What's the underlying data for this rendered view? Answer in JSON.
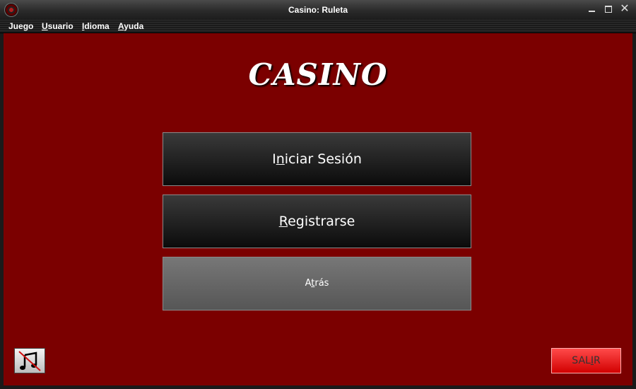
{
  "window": {
    "title": "Casino: Ruleta"
  },
  "menu": [
    {
      "pre": "Jue",
      "key": "g",
      "post": "o"
    },
    {
      "pre": "",
      "key": "U",
      "post": "suario"
    },
    {
      "pre": "",
      "key": "I",
      "post": "dioma"
    },
    {
      "pre": "",
      "key": "A",
      "post": "yuda"
    }
  ],
  "heading": "CASINO",
  "buttons": {
    "login": {
      "pre": "I",
      "key": "n",
      "post": "iciar Sesión"
    },
    "register": {
      "pre": "",
      "key": "R",
      "post": "egistrarse"
    },
    "back": {
      "pre": "A",
      "key": "t",
      "post": "rás"
    },
    "exit": {
      "pre": "SAL",
      "key": "I",
      "post": "R"
    }
  },
  "music": {
    "icon": "music-muted-icon"
  },
  "colors": {
    "background": "#7b0000",
    "exit_button": "#e81010"
  }
}
